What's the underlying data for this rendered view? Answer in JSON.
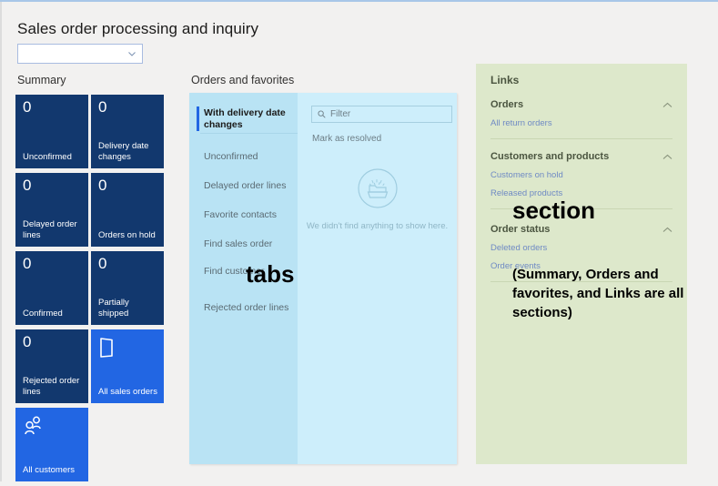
{
  "page": {
    "title": "Sales order processing and inquiry",
    "filter_select_value": "",
    "filter_select_icon": "chevron-down-icon"
  },
  "summary": {
    "heading": "Summary",
    "tiles": [
      {
        "count": "0",
        "label": "Unconfirmed",
        "kind": "count"
      },
      {
        "count": "0",
        "label": "Delivery date changes",
        "kind": "count"
      },
      {
        "count": "0",
        "label": "Delayed order lines",
        "kind": "count"
      },
      {
        "count": "0",
        "label": "Orders on hold",
        "kind": "count"
      },
      {
        "count": "0",
        "label": "Confirmed",
        "kind": "count"
      },
      {
        "count": "0",
        "label": "Partially shipped",
        "kind": "count"
      },
      {
        "count": "0",
        "label": "Rejected order lines",
        "kind": "count"
      },
      {
        "count": "",
        "label": "All sales orders",
        "kind": "action",
        "icon": "document-icon"
      },
      {
        "count": "",
        "label": "All customers",
        "kind": "action",
        "icon": "people-icon"
      }
    ]
  },
  "orders_and_favorites": {
    "heading": "Orders and favorites",
    "tabs": [
      {
        "label": "With delivery date changes",
        "active": true
      },
      {
        "label": "Unconfirmed",
        "active": false
      },
      {
        "label": "Delayed order lines",
        "active": false
      },
      {
        "label": "Favorite contacts",
        "active": false
      },
      {
        "label": "Find sales order",
        "active": false
      },
      {
        "label": "Find customer",
        "active": false
      },
      {
        "label": "Rejected order lines",
        "active": false
      }
    ],
    "filter_placeholder": "Filter",
    "filter_value": "",
    "filter_icon": "search-icon",
    "command_label": "Mark as resolved",
    "empty_icon": "empty-folder-icon",
    "empty_message": "We didn't find anything to show here."
  },
  "links": {
    "heading": "Links",
    "groups": [
      {
        "title": "Orders",
        "toggle_icon": "chevron-up-icon",
        "items": [
          "All return orders"
        ]
      },
      {
        "title": "Customers and products",
        "toggle_icon": "chevron-up-icon",
        "items": [
          "Customers on hold",
          "Released products"
        ]
      },
      {
        "title": "Order status",
        "toggle_icon": "chevron-up-icon",
        "items": [
          "Deleted orders",
          "Order events"
        ]
      }
    ]
  },
  "annotations": {
    "tabs": "tabs",
    "section": "section",
    "note": "(Summary, Orders and favorites, and Links are all sections)"
  },
  "colors": {
    "page_background": "#f2f1f0",
    "count_tile": "#12386e",
    "action_tile": "#2266e3",
    "orders_panel": "#cdeefb",
    "orders_tabs": "#b9e3f4",
    "links_panel": "#dde8cb",
    "link_text": "#6f8ac4",
    "accent": "#2266e3"
  }
}
